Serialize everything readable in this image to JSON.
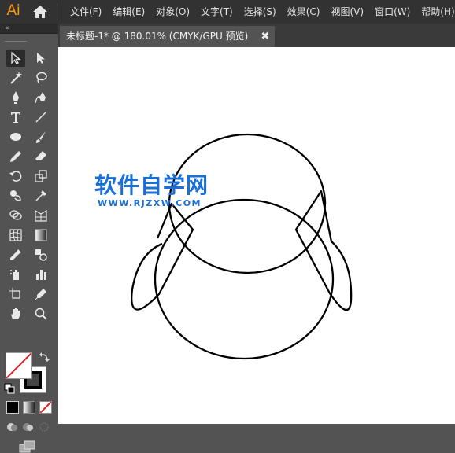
{
  "app": {
    "logo_text": "Ai",
    "logo_color": "#ff9a00"
  },
  "menu": {
    "items": [
      {
        "label": "文件(F)"
      },
      {
        "label": "编辑(E)"
      },
      {
        "label": "对象(O)"
      },
      {
        "label": "文字(T)"
      },
      {
        "label": "选择(S)"
      },
      {
        "label": "效果(C)"
      },
      {
        "label": "视图(V)"
      },
      {
        "label": "窗口(W)"
      },
      {
        "label": "帮助(H)"
      }
    ]
  },
  "toolbar": {
    "collapse_icon": "«",
    "tools": [
      "selection-tool-icon",
      "direct-selection-tool-icon",
      "magic-wand-tool-icon",
      "lasso-tool-icon",
      "pen-tool-icon",
      "curvature-tool-icon",
      "type-tool-icon",
      "line-segment-tool-icon",
      "ellipse-tool-icon",
      "paintbrush-tool-icon",
      "pencil-tool-icon",
      "eraser-tool-icon",
      "rotate-tool-icon",
      "scale-tool-icon",
      "warp-tool-icon",
      "puppet-warp-tool-icon",
      "shape-builder-tool-icon",
      "perspective-grid-tool-icon",
      "mesh-tool-icon",
      "gradient-tool-icon",
      "eyedropper-tool-icon",
      "blend-tool-icon",
      "symbol-sprayer-tool-icon",
      "column-graph-tool-icon",
      "artboard-tool-icon",
      "slice-tool-icon",
      "hand-tool-icon",
      "zoom-tool-icon"
    ],
    "active_tool": "selection-tool-icon",
    "fill_color": "none",
    "stroke_color": "#000000"
  },
  "document": {
    "tab_title": "未标题-1* @ 180.01% (CMYK/GPU 预览)",
    "close_glyph": "✖"
  },
  "watermark": {
    "logo_text": "软件自学网",
    "url_text": "WWW.RJZXW.COM",
    "color": "#1a6fd6"
  }
}
